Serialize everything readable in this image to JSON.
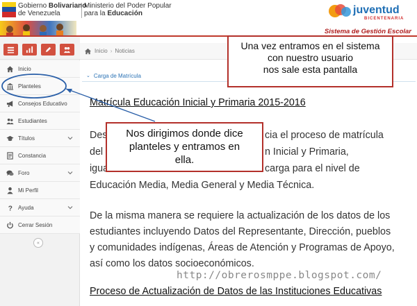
{
  "header": {
    "gov_line1_prefix": "Gobierno ",
    "gov_line1_bold": "Bolivariano",
    "gov_line2": "de Venezuela",
    "ministry_line1": "Ministerio del Poder Popular",
    "ministry_line2_prefix": "para la ",
    "ministry_line2_bold": "Educación",
    "juventud_logo_text": "juventud",
    "juventud_logo_sub": "BICENTENARIA",
    "system_title": "Sistema de Gestión Escolar"
  },
  "sidebar": {
    "toolbar_icons": [
      "grid-icon",
      "bar-chart-icon",
      "pencil-icon",
      "users-icon"
    ],
    "items": [
      {
        "label": "Inicio",
        "icon": "home-icon",
        "has_chevron": false
      },
      {
        "label": "Planteles",
        "icon": "institution-icon",
        "has_chevron": false
      },
      {
        "label": "Consejos Educativo",
        "icon": "megaphone-icon",
        "has_chevron": false
      },
      {
        "label": "Estudiantes",
        "icon": "users-icon",
        "has_chevron": false
      },
      {
        "label": "Títulos",
        "icon": "graduation-icon",
        "has_chevron": true
      },
      {
        "label": "Constancia",
        "icon": "document-icon",
        "has_chevron": false
      },
      {
        "label": "Foro",
        "icon": "comments-icon",
        "has_chevron": true
      },
      {
        "label": "Mi Perfil",
        "icon": "user-icon",
        "has_chevron": false
      },
      {
        "label": "Ayuda",
        "icon": "question-icon",
        "has_chevron": true
      },
      {
        "label": "Cerrar Sesión",
        "icon": "power-icon",
        "has_chevron": false
      }
    ],
    "collapse_glyph": "«"
  },
  "breadcrumb": {
    "home": "Inicio",
    "separator": "›",
    "current": "Noticias"
  },
  "panel": {
    "title": "Carga de Matrícula",
    "caret": "⌄"
  },
  "content": {
    "heading1": "Matrícula Educación Inicial y Primaria 2015-2016",
    "para1_line1": "Desde este momento se da inicio el proceso de matrícula",
    "para1_line2": "del año escolar 2015-2016 para Educación Inicial y Primaria,",
    "para1_line3": "igualmente se abrirá el proceso de carga para el nivel de",
    "para1_line4": "Educación Media, Media General y Media Técnica.",
    "para1_visible_left_a": "Des",
    "para1_visible_right_a": "cia el proceso de matrícula",
    "para1_visible_left_b": "del",
    "para1_visible_right_b": "n Inicial y Primaria,",
    "para1_visible_left_c": "igua",
    "para1_visible_right_c": "carga para el nivel de",
    "para2_line1": "De la misma manera se requiere la actualización de los datos de los",
    "para2_line2": "estudiantes incluyendo Datos del Representante, Dirección, pueblos",
    "para2_line3": "y comunidades indígenas, Áreas de Atención y Programas de Apoyo,",
    "para2_line4": "así como los datos socioeconómicos.",
    "heading2": "Proceso de Actualización de Datos de las Instituciones Educativas",
    "watermark": "http://obrerosmppe.blogspot.com/"
  },
  "callouts": {
    "top_line1": "Una vez entramos en el sistema",
    "top_line2": "con nuestro usuario",
    "top_line3": "nos sale esta pantalla",
    "mid_line1": "Nos dirigimos donde dice",
    "mid_line2": "planteles y entramos en",
    "mid_line3": "ella."
  },
  "colors": {
    "accent_red": "#d2503f",
    "callout_border": "#b3302a",
    "link_blue": "#2a72b5",
    "annotation_blue": "#2a5fa8"
  }
}
